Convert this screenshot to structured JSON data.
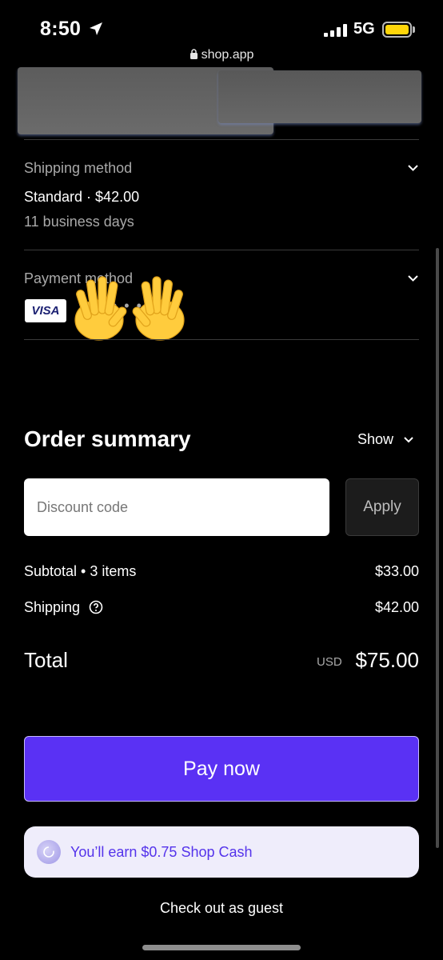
{
  "status_bar": {
    "time": "8:50",
    "network": "5G",
    "url": "shop.app"
  },
  "shipping": {
    "label": "Shipping method",
    "value": "Standard · $42.00",
    "eta": "11 business days"
  },
  "payment": {
    "label": "Payment method",
    "card_brand": "VISA",
    "masked": "• • • •"
  },
  "order_summary": {
    "title": "Order summary",
    "toggle_label": "Show",
    "discount_placeholder": "Discount code",
    "apply_label": "Apply",
    "subtotal_label": "Subtotal • 3 items",
    "subtotal_value": "$33.00",
    "shipping_label": "Shipping",
    "shipping_value": "$42.00",
    "total_label": "Total",
    "total_currency": "USD",
    "total_value": "$75.00"
  },
  "actions": {
    "pay_label": "Pay now",
    "shop_cash_text": "You’ll earn $0.75 Shop Cash",
    "guest_label": "Check out as guest"
  },
  "colors": {
    "accent": "#5a31f4",
    "shop_cash_bg": "#efedfb",
    "shop_cash_text": "#5433eb"
  },
  "icons": [
    "location-arrow-icon",
    "signal-icon",
    "battery-icon",
    "lock-icon",
    "chevron-down-icon",
    "help-circle-icon",
    "shop-cash-icon",
    "raised-hands-emoji"
  ]
}
